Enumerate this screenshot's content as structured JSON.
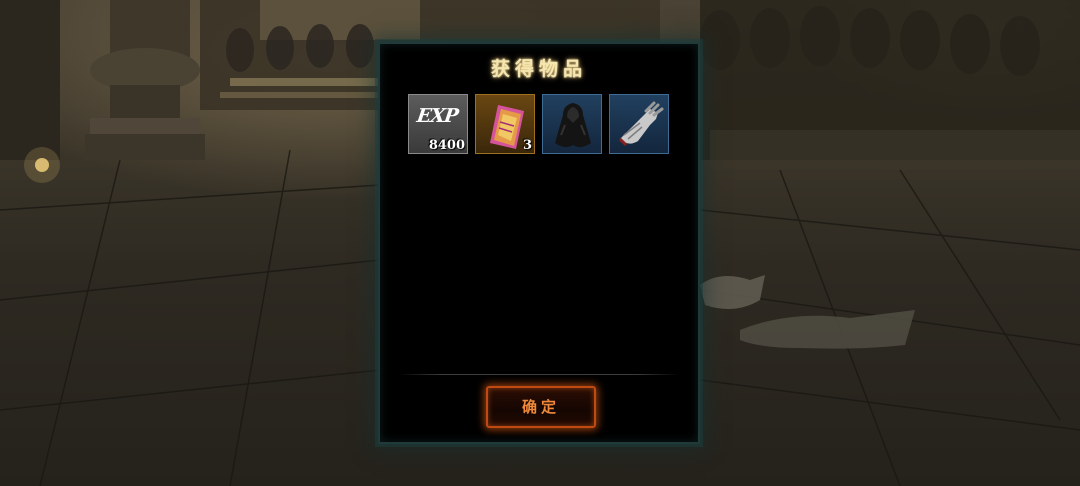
{
  "dialog": {
    "title": "获得物品",
    "confirm_label": "确定"
  },
  "items": [
    {
      "name": "exp",
      "label": "EXP",
      "count": "8400",
      "icon": "exp-icon",
      "rarity_color": "#5c5c5c"
    },
    {
      "name": "scroll",
      "count": "3",
      "icon": "scroll-icon",
      "rarity_color": "#6a4712"
    },
    {
      "name": "cloak",
      "count": "",
      "icon": "cloak-icon",
      "rarity_color": "#21405f"
    },
    {
      "name": "gauntlet",
      "count": "",
      "icon": "gauntlet-icon",
      "rarity_color": "#21405f"
    }
  ],
  "colors": {
    "title": "#f4e6b0",
    "button_border": "#c04a12",
    "button_text": "#f08a3a",
    "dialog_border": "#203a3a"
  }
}
